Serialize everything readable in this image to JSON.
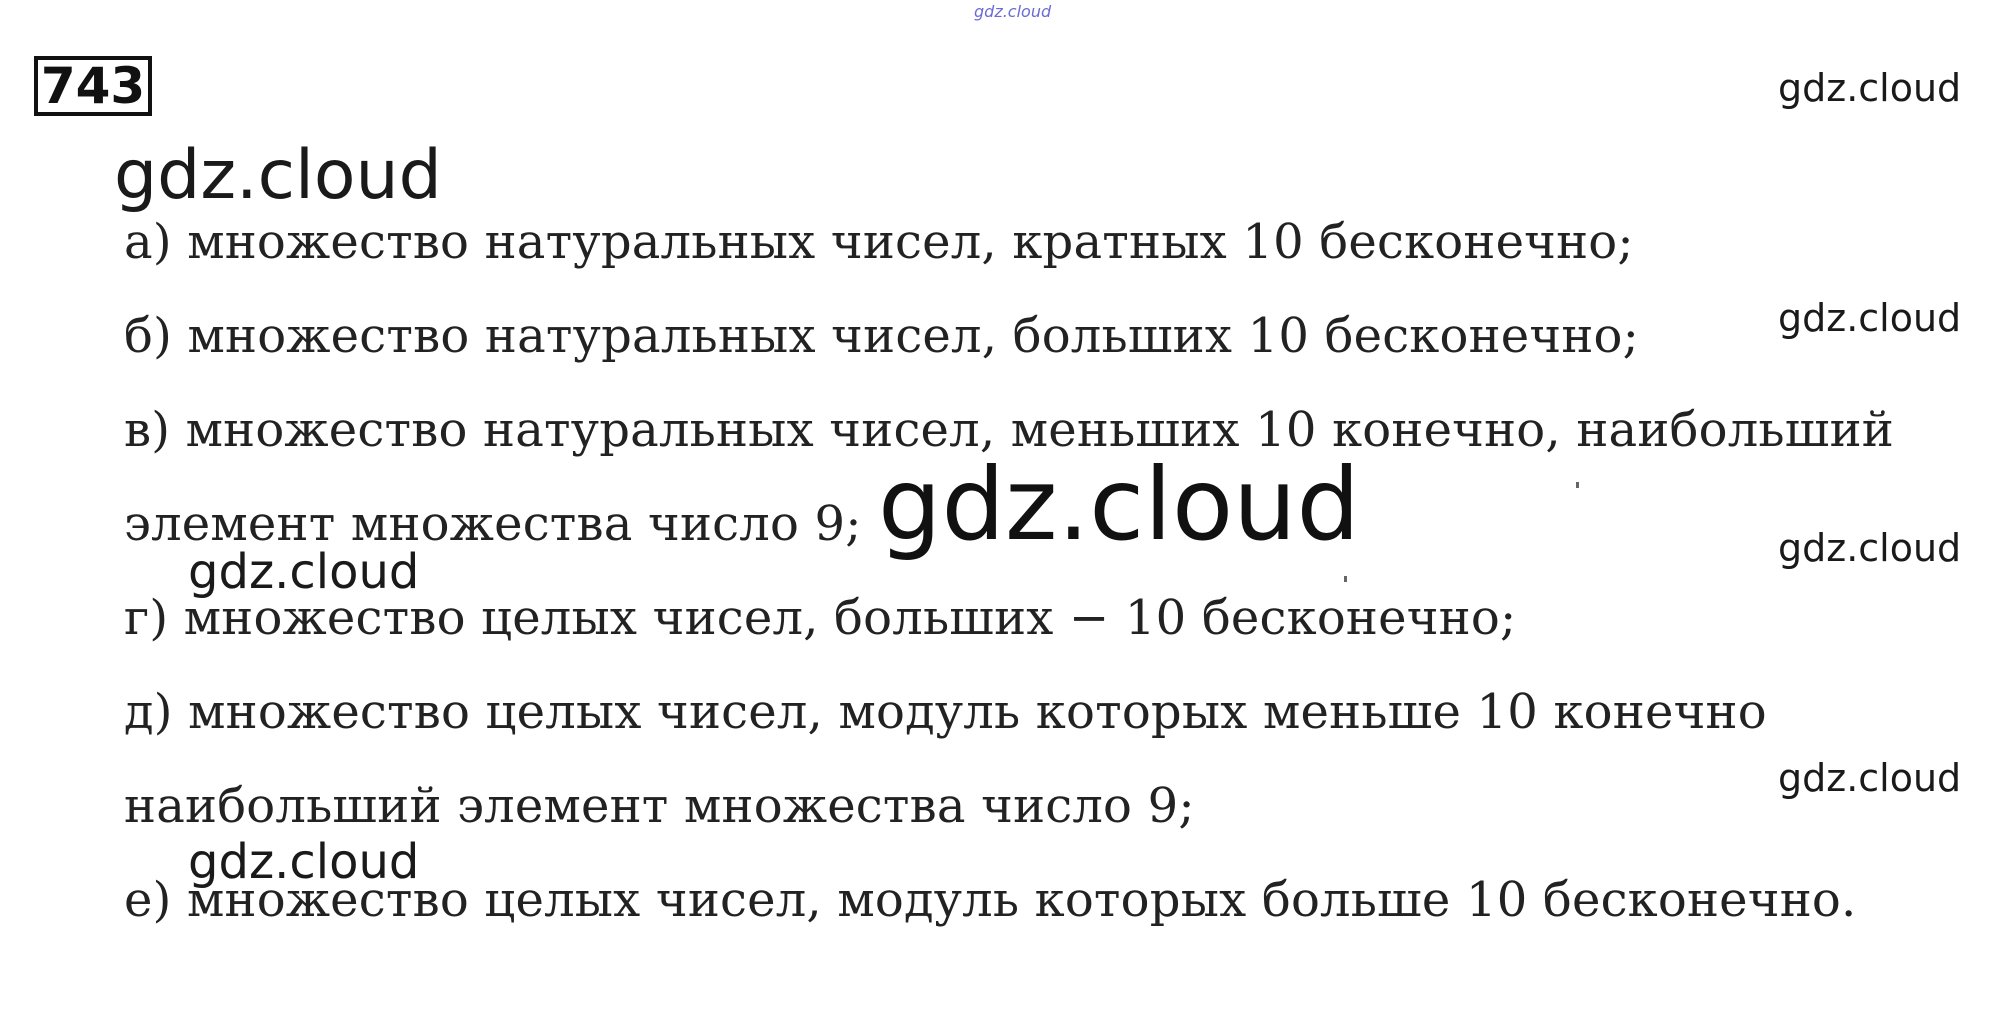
{
  "problem": {
    "number": "743"
  },
  "watermarks": {
    "tiny_top": "gdz.cloud",
    "right_1": "gdz.cloud",
    "right_2": "gdz.cloud",
    "right_3": "gdz.cloud",
    "right_4": "gdz.cloud",
    "large_left": "gdz.cloud",
    "center_huge": "gdz.cloud",
    "left_mid_1": "gdz.cloud",
    "left_mid_2": "gdz.cloud"
  },
  "lines": [
    "а) множество натуральных чисел, кратных 10 бесконечно;",
    "б) множество натуральных чисел, больших 10 бесконечно;",
    "в) множество натуральных чисел, меньших 10 конечно, наибольший",
    "элемент множества число 9;",
    "г) множество целых чисел, больших  − 10 бесконечно;",
    "д) множество целых чисел, модуль которых меньше 10 конечно",
    "наибольший элемент множества число 9;",
    "е) множество целых чисел, модуль которых больше 10 бесконечно."
  ]
}
